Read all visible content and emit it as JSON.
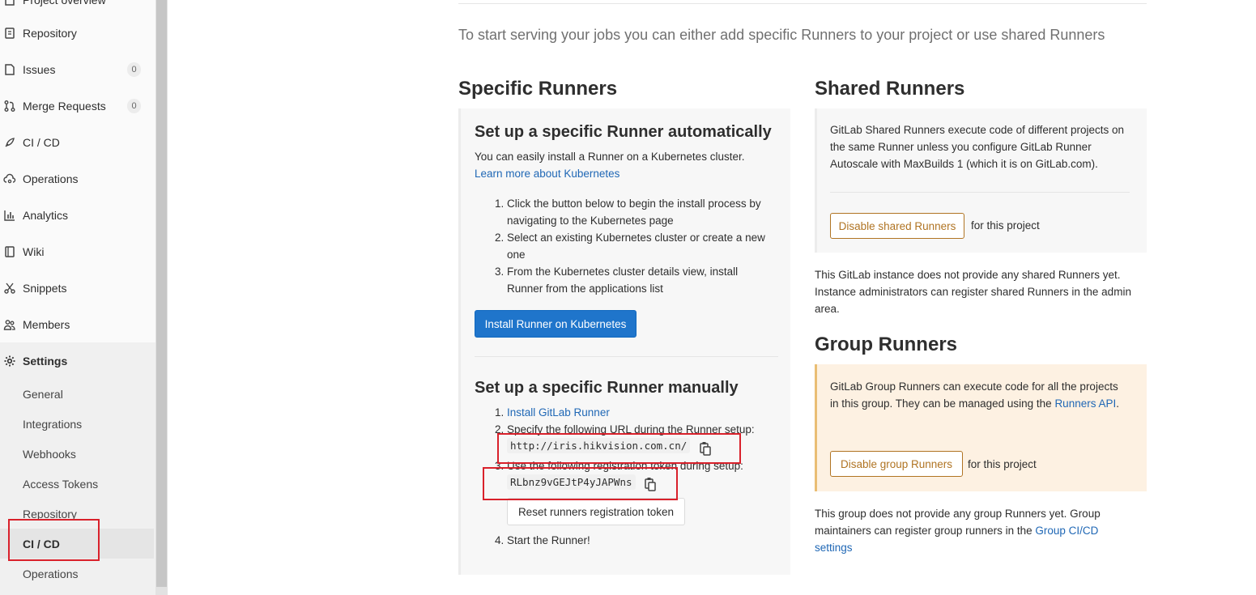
{
  "sidebar": {
    "top_partial_label": "Project overview",
    "items": [
      {
        "label": "Repository",
        "icon": "book-icon"
      },
      {
        "label": "Issues",
        "icon": "issues-icon",
        "count": "0"
      },
      {
        "label": "Merge Requests",
        "icon": "merge-request-icon",
        "count": "0"
      },
      {
        "label": "CI / CD",
        "icon": "rocket-icon"
      },
      {
        "label": "Operations",
        "icon": "cloud-gear-icon"
      },
      {
        "label": "Analytics",
        "icon": "chart-icon"
      },
      {
        "label": "Wiki",
        "icon": "book-icon"
      },
      {
        "label": "Snippets",
        "icon": "scissors-icon"
      },
      {
        "label": "Members",
        "icon": "users-icon"
      }
    ],
    "settings": {
      "label": "Settings",
      "icon": "gear-icon",
      "sub_items": [
        "General",
        "Integrations",
        "Webhooks",
        "Access Tokens",
        "Repository",
        "CI / CD",
        "Operations"
      ],
      "active": "CI / CD"
    }
  },
  "main": {
    "intro": "To start serving your jobs you can either add specific Runners to your project or use shared Runners",
    "specific": {
      "title": "Specific Runners",
      "auto": {
        "title": "Set up a specific Runner automatically",
        "desc": "You can easily install a Runner on a Kubernetes cluster.",
        "link": "Learn more about Kubernetes",
        "steps": [
          [
            "Click the button below to begin the install process by",
            "navigating to the Kubernetes page"
          ],
          [
            "Select an existing Kubernetes cluster or create a new",
            "one"
          ],
          [
            "From the Kubernetes cluster details view, install",
            "Runner from the applications list"
          ]
        ],
        "button": "Install Runner on Kubernetes"
      },
      "manual": {
        "title": "Set up a specific Runner manually",
        "step1_link": "Install GitLab Runner",
        "step2_text": "Specify the following URL during the Runner setup:",
        "url": "http://iris.hikvision.com.cn/",
        "step3_text": "Use the following registration token during setup:",
        "token": "RLbnz9vGEJtP4yJAPWns",
        "reset_button": "Reset runners registration token",
        "step4_text": "Start the Runner!"
      }
    },
    "shared": {
      "title": "Shared Runners",
      "desc_lines": [
        "GitLab Shared Runners execute code of different projects on",
        "the same Runner unless you configure GitLab Runner",
        "Autoscale with MaxBuilds 1 (which it is on GitLab.com)."
      ],
      "button": "Disable shared Runners",
      "suffix": "for this project",
      "note_lines": [
        "This GitLab instance does not provide any shared Runners yet.",
        "Instance administrators can register shared Runners in the admin",
        "area."
      ]
    },
    "group": {
      "title": "Group Runners",
      "desc_line1": "GitLab Group Runners can execute code for all the projects",
      "desc_line2": "in this group. They can be managed using the ",
      "desc_link": "Runners API",
      "desc_end": ".",
      "button": "Disable group Runners",
      "suffix": "for this project",
      "note_line1": "This group does not provide any group Runners yet. Group",
      "note_line2": "maintainers can register group runners in the ",
      "note_link1": "Group CI/CD",
      "note_link2": "settings"
    }
  },
  "colors": {
    "primary": "#1f75cb",
    "warning": "#b07423",
    "highlight": "#d9212b",
    "group_bg": "#fdf1e2",
    "group_border": "#e9be74"
  }
}
